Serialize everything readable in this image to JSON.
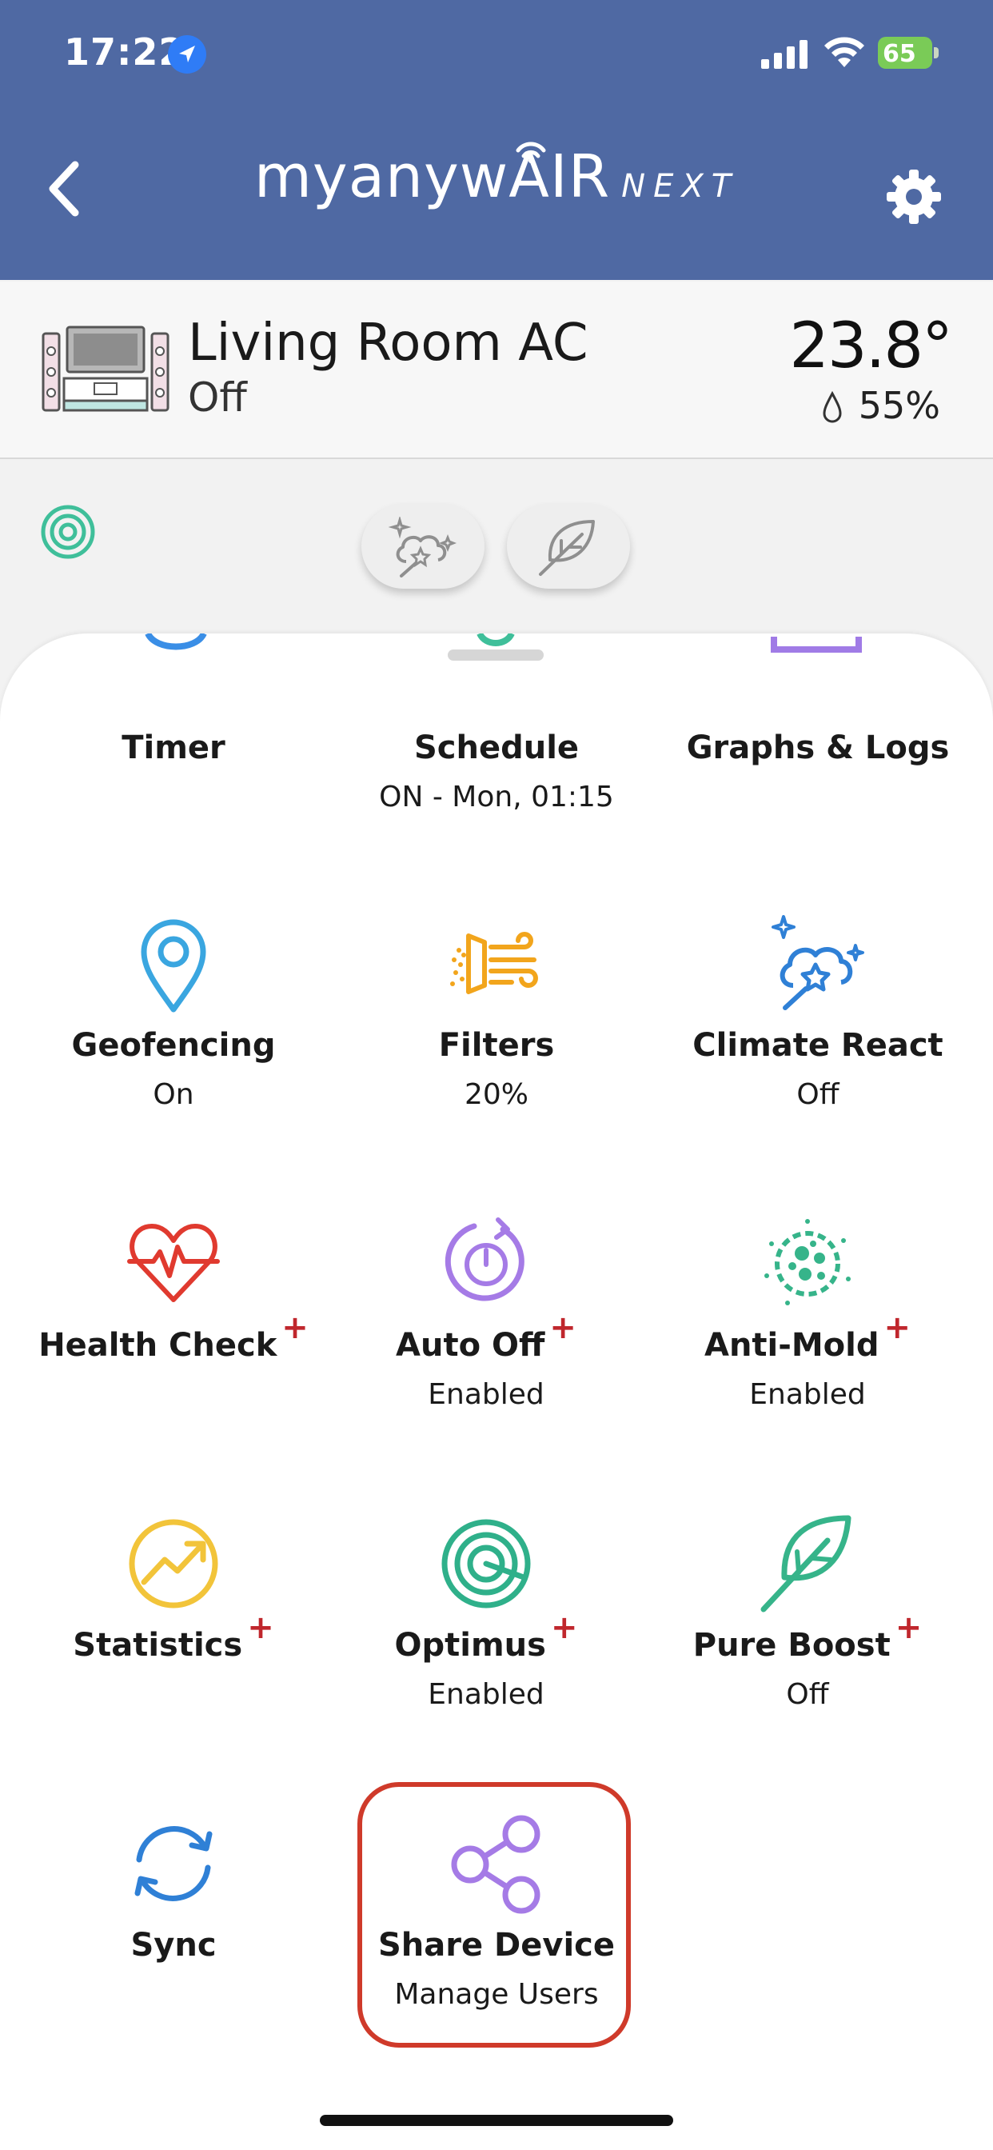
{
  "status_bar": {
    "time": "17:22",
    "battery": "65"
  },
  "header": {
    "brand": "myanywAIR",
    "brand_suffix": "NEXT"
  },
  "device": {
    "name": "Living Room AC",
    "state": "Off",
    "temperature": "23.8°",
    "humidity": "55%"
  },
  "features": {
    "timer": {
      "label": "Timer"
    },
    "schedule": {
      "label": "Schedule",
      "sub": "ON - Mon, 01:15"
    },
    "graphs": {
      "label": "Graphs & Logs"
    },
    "geofencing": {
      "label": "Geofencing",
      "sub": "On"
    },
    "filters": {
      "label": "Filters",
      "sub": "20%"
    },
    "climate_react": {
      "label": "Climate React",
      "sub": "Off"
    },
    "health_check": {
      "label": "Health Check",
      "plus": "+"
    },
    "auto_off": {
      "label": "Auto Off",
      "sub": "Enabled",
      "plus": "+"
    },
    "anti_mold": {
      "label": "Anti-Mold",
      "sub": "Enabled",
      "plus": "+"
    },
    "statistics": {
      "label": "Statistics",
      "plus": "+"
    },
    "optimus": {
      "label": "Optimus",
      "sub": "Enabled",
      "plus": "+"
    },
    "pure_boost": {
      "label": "Pure Boost",
      "sub": "Off",
      "plus": "+"
    },
    "sync": {
      "label": "Sync"
    },
    "share_device": {
      "label": "Share Device",
      "sub": "Manage Users"
    }
  },
  "colors": {
    "header_bg": "#4f69a3",
    "highlight": "#cf3a2a",
    "plus_mark": "#c0272d"
  }
}
